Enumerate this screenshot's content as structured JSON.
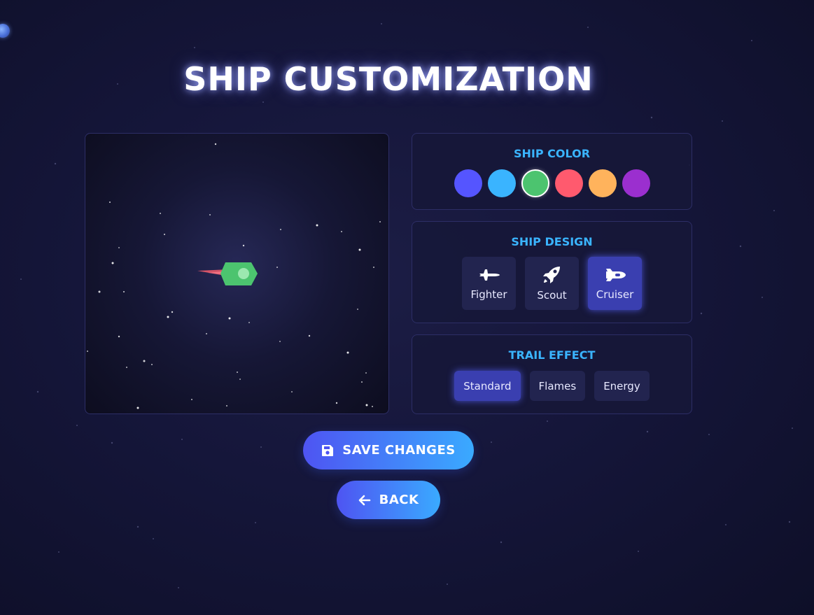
{
  "page": {
    "title": "SHIP CUSTOMIZATION"
  },
  "ship_color": {
    "title": "SHIP COLOR",
    "swatches": [
      {
        "name": "blue-violet",
        "color": "#5555ff",
        "selected": false
      },
      {
        "name": "sky-blue",
        "color": "#3ab4ff",
        "selected": false
      },
      {
        "name": "green",
        "color": "#4cc46f",
        "selected": true
      },
      {
        "name": "red",
        "color": "#ff5a6e",
        "selected": false
      },
      {
        "name": "orange",
        "color": "#ffb35c",
        "selected": false
      },
      {
        "name": "purple",
        "color": "#9b2fcf",
        "selected": false
      }
    ]
  },
  "ship_design": {
    "title": "SHIP DESIGN",
    "options": [
      {
        "label": "Fighter",
        "icon": "fighter-jet-icon",
        "selected": false
      },
      {
        "label": "Scout",
        "icon": "rocket-icon",
        "selected": false
      },
      {
        "label": "Cruiser",
        "icon": "space-shuttle-icon",
        "selected": true
      }
    ]
  },
  "trail_effect": {
    "title": "TRAIL EFFECT",
    "options": [
      {
        "label": "Standard",
        "selected": true
      },
      {
        "label": "Flames",
        "selected": false
      },
      {
        "label": "Energy",
        "selected": false
      }
    ]
  },
  "actions": {
    "save_label": "SAVE CHANGES",
    "save_icon": "floppy-disk-icon",
    "back_label": "BACK",
    "back_icon": "arrow-left-icon"
  },
  "preview": {
    "ship_color": "#4cc46f",
    "ship_accent": "#9ce8b0",
    "trail_color": "#e85a6a"
  }
}
